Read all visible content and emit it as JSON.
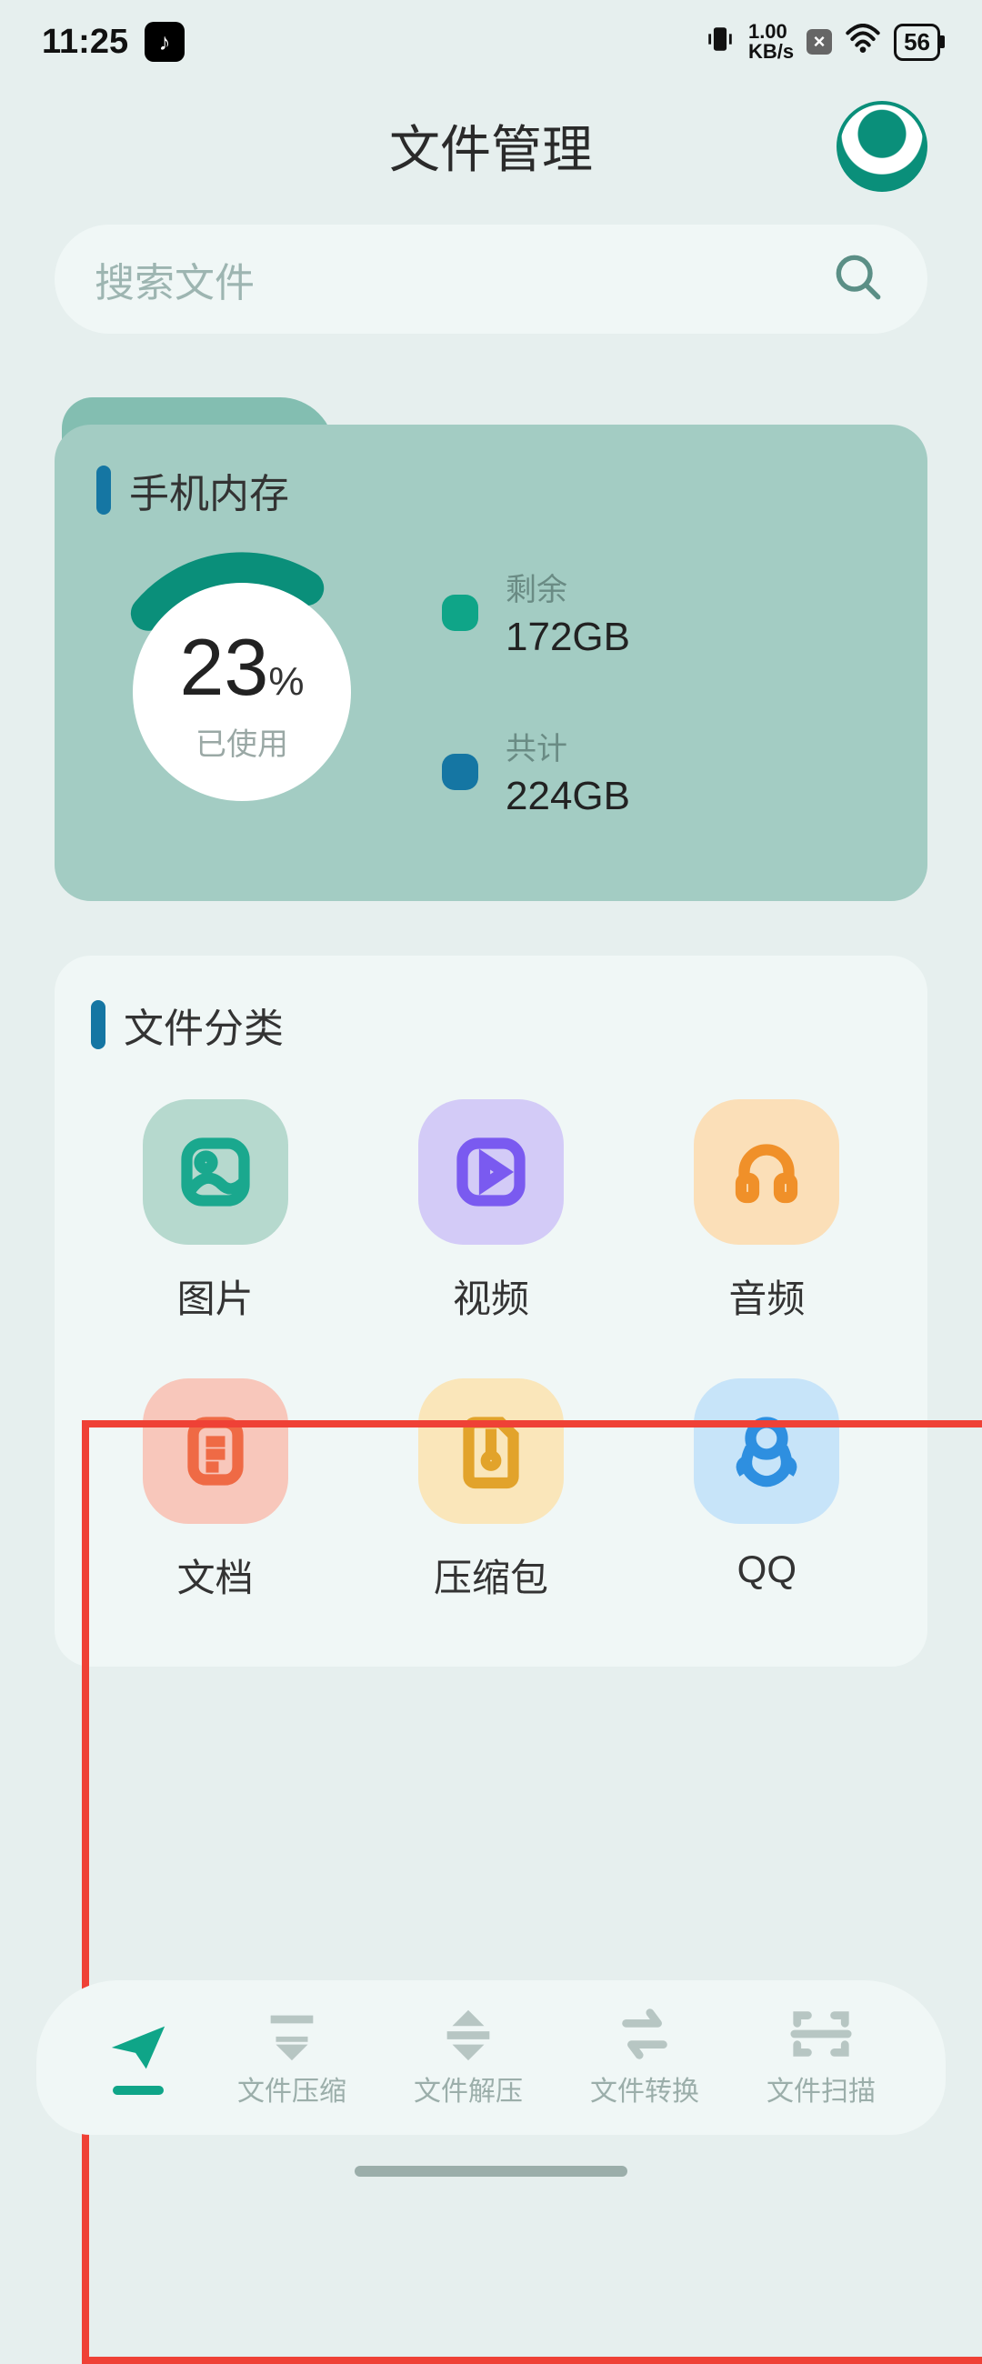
{
  "status": {
    "time": "11:25",
    "tiktok_glyph": "♪",
    "net_rate_value": "1.00",
    "net_rate_unit": "KB/s",
    "x_glyph": "×",
    "battery": "56"
  },
  "header": {
    "title": "文件管理"
  },
  "search": {
    "placeholder": "搜索文件"
  },
  "storage": {
    "title": "手机内存",
    "used_pct": "23",
    "used_label": "已使用",
    "remaining_label": "剩余",
    "remaining_value": "172GB",
    "total_label": "共计",
    "total_value": "224GB"
  },
  "categories": {
    "title": "文件分类",
    "items": {
      "0": {
        "label": "图片"
      },
      "1": {
        "label": "视频"
      },
      "2": {
        "label": "音频"
      },
      "3": {
        "label": "文档"
      },
      "4": {
        "label": "压缩包"
      },
      "5": {
        "label": "QQ"
      }
    }
  },
  "nav": {
    "0": {
      "label": ""
    },
    "1": {
      "label": "文件压缩"
    },
    "2": {
      "label": "文件解压"
    },
    "3": {
      "label": "文件转换"
    },
    "4": {
      "label": "文件扫描"
    }
  }
}
